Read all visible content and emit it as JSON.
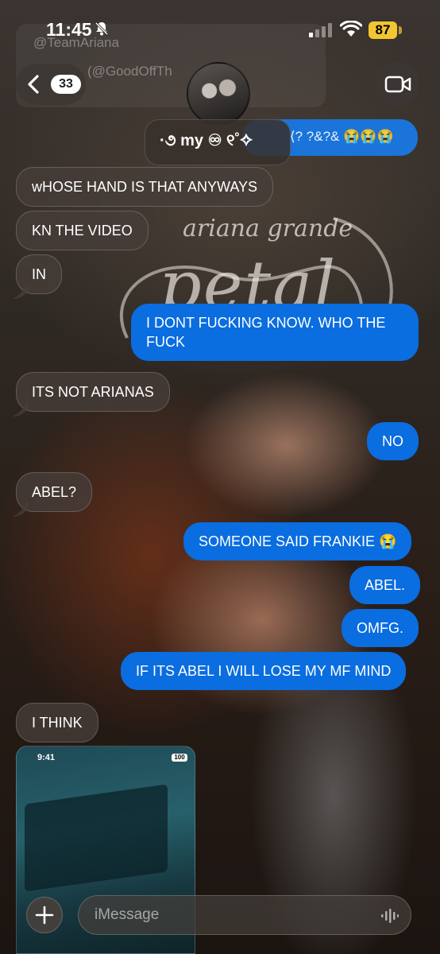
{
  "status_bar": {
    "time": "11:45",
    "battery": "87"
  },
  "header": {
    "back_count": "33",
    "contact_name": "·૭ my ♾ ୧˚✧"
  },
  "partial_message": "⟨? ?&?& 😭😭😭",
  "background_text": {
    "ghost_line1": "@TeamAriana",
    "ghost_line2": "(@GoodOffTh",
    "script_small": "ariana grande",
    "script_large": "petal"
  },
  "messages": [
    {
      "side": "in",
      "text": "wHOSE HAND IS THAT ANYWAYS"
    },
    {
      "side": "in",
      "text": "KN THE VIDEO"
    },
    {
      "side": "in",
      "text": "IN"
    },
    {
      "side": "out",
      "text": "I DONT FUCKING KNOW. WHO THE FUCK"
    },
    {
      "side": "in",
      "text": "ITS NOT ARIANAS"
    },
    {
      "side": "out",
      "text": "NO"
    },
    {
      "side": "in",
      "text": "ABEL?"
    },
    {
      "side": "out",
      "text": "SOMEONE SAID FRANKIE 😭"
    },
    {
      "side": "out",
      "text": "ABEL."
    },
    {
      "side": "out",
      "text": "OMFG."
    },
    {
      "side": "out",
      "text": "IF ITS ABEL I WILL LOSE MY MF MIND"
    },
    {
      "side": "in",
      "text": "I THINK"
    }
  ],
  "embedded_screenshot": {
    "time": "9:41",
    "battery": "100"
  },
  "composer": {
    "placeholder": "iMessage"
  },
  "colors": {
    "outgoing_bubble": "#0a6de0",
    "battery": "#f3c631"
  }
}
